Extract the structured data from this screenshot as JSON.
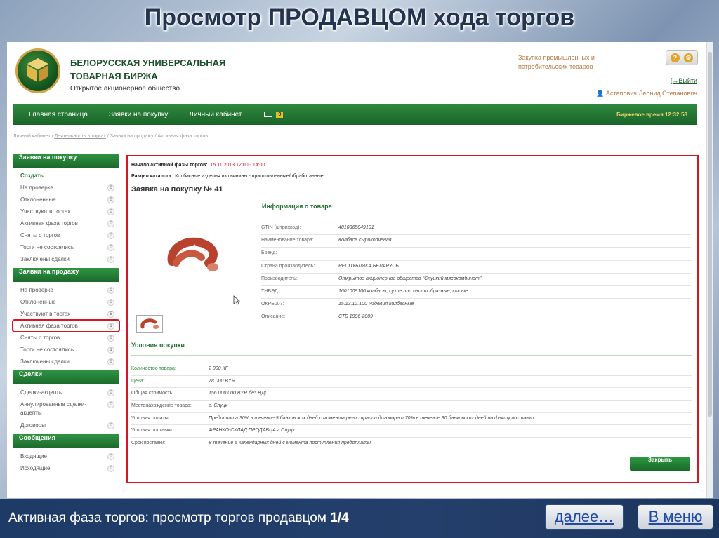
{
  "slide": {
    "title": "Просмотр ПРОДАВЦОМ хода торгов",
    "caption_main": "Активная фаза торгов: просмотр торгов продавцом ",
    "caption_page": "1/4",
    "next_label": "далее…",
    "menu_label": "В меню"
  },
  "header": {
    "brand_line1": "БЕЛОРУССКАЯ УНИВЕРСАЛЬНАЯ",
    "brand_line2": "ТОВАРНАЯ БИРЖА",
    "brand_sub": "Открытое акционерное общество",
    "section_line1": "Закупка промышленных и",
    "section_line2": "потребительских товаров",
    "help_label": "?",
    "gear_label": "⚙",
    "logout": "[→Выйти",
    "user": "👤 Астапович Леонид Степанович"
  },
  "nav": {
    "items": [
      "Главная страница",
      "Заявки на покупку",
      "Личный кабинет"
    ],
    "mail_badge": "0",
    "time": "Биржевое время 12:32:58"
  },
  "breadcrumb": {
    "a": "Личный кабинет / ",
    "b": "Деятельность в торгах",
    "c": " / Заявки на продажу / Активная фаза торгов"
  },
  "sidebar": {
    "sections": [
      {
        "title": "Заявки на покупку",
        "items": [
          {
            "label": "Создать"
          },
          {
            "label": "На проверке",
            "count": "0"
          },
          {
            "label": "Отклоненные",
            "count": "0"
          },
          {
            "label": "Участвуют в торгах",
            "count": "0"
          },
          {
            "label": "Активная фаза торгов",
            "count": "0"
          },
          {
            "label": "Сняты с торгов",
            "count": "0"
          },
          {
            "label": "Торги не состоялись",
            "count": "0"
          },
          {
            "label": "Заключены сделки",
            "count": "0"
          }
        ]
      },
      {
        "title": "Заявки на продажу",
        "items": [
          {
            "label": "На проверке",
            "count": "0"
          },
          {
            "label": "Отклоненные",
            "count": "0"
          },
          {
            "label": "Участвуют в торгах",
            "count": "5"
          },
          {
            "label": "Активная фаза торгов",
            "count": "1"
          },
          {
            "label": "Сняты с торгов",
            "count": "0"
          },
          {
            "label": "Торги не состоялись",
            "count": "1"
          },
          {
            "label": "Заключены сделки",
            "count": "0"
          }
        ]
      },
      {
        "title": "Сделки",
        "items": [
          {
            "label": "Сделки-акцепты",
            "count": "0"
          },
          {
            "label": "Аннулированные сделки-акцепты",
            "count": "0"
          },
          {
            "label": "Договоры",
            "count": "0"
          }
        ]
      },
      {
        "title": "Сообщения",
        "items": [
          {
            "label": "Входящие",
            "count": "0"
          },
          {
            "label": "Исходящие",
            "count": "0"
          }
        ]
      }
    ]
  },
  "main": {
    "phase_label": "Начало активной фазы торгов:",
    "phase_value": "15.11.2013 12:00 - 14:00",
    "catalog_label": "Раздел каталога:",
    "catalog_value": "Колбасные изделия из свинины - приготовленные/обработанные",
    "title": "Заявка на покупку № 41",
    "info_title": "Информация о товаре",
    "info": [
      {
        "label": "GTIN (штрихкод):",
        "value": "4810865049191"
      },
      {
        "label": "Наименование товара:",
        "value": "Колбаса сырокопченая"
      },
      {
        "label": "Бренд:",
        "value": ""
      },
      {
        "label": "Страна производитель:",
        "value": "РЕСПУБЛИКА БЕЛАРУСЬ"
      },
      {
        "label": "Производитель:",
        "value": "Открытое акционерное общество \"Слуцкий мясокомбинат\""
      },
      {
        "label": "ТНВЭД:",
        "value": "1601009100 колбасы, сухие или пастообразные, сырые"
      },
      {
        "label": "ОКРБ007:",
        "value": "15.13.12.100 Изделия колбасные"
      },
      {
        "label": "Описание:",
        "value": "СТБ 1996-2009"
      }
    ],
    "conditions_title": "Условия покупки",
    "conditions": [
      {
        "label": "Количество товара:",
        "value": "2 000 КГ"
      },
      {
        "label": "Цена:",
        "value": "78 000 BYR"
      },
      {
        "label": "Общая стоимость:",
        "value": "156 000 000 BYR без НДС"
      },
      {
        "label": "Местонахождение товара:",
        "value": "г. Слуцк"
      },
      {
        "label": "Условия оплаты:",
        "value": "Предоплата 30% в течение 5 банковских дней с момента регистрации договора и 70% в течение 30 банковских дней по факту поставки"
      },
      {
        "label": "Условия поставки:",
        "value": "ФРАНКО-СКЛАД ПРОДАВЦА г.Слуцк"
      },
      {
        "label": "Срок поставки:",
        "value": "В течение 5 календарных дней с момента поступления предоплаты"
      }
    ],
    "close_label": "Закрыть"
  }
}
